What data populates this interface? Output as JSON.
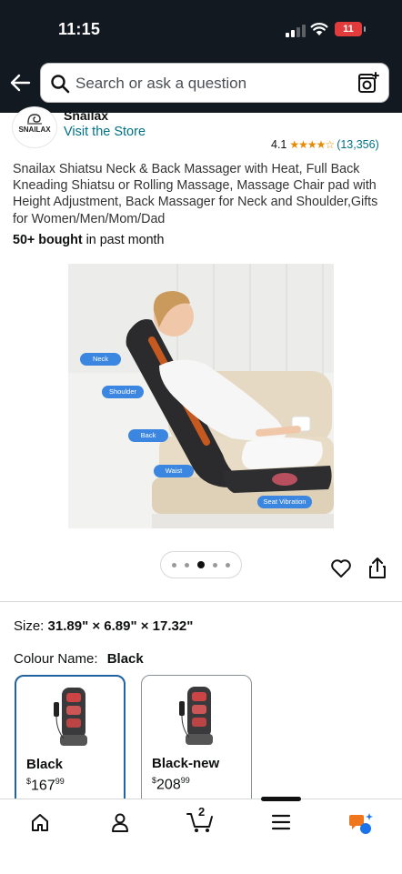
{
  "status_bar": {
    "time": "11:15",
    "battery": "11"
  },
  "search": {
    "placeholder": "Search or ask a question"
  },
  "brand": {
    "logo_text": "SNAILAX",
    "name": "Snailax",
    "visit_store": "Visit the Store"
  },
  "rating": {
    "value": "4.1",
    "stars": "★★★★☆",
    "count": "(13,356)"
  },
  "product": {
    "title": "Snailax Shiatsu Neck & Back Massager with Heat, Full Back Kneading Shiatsu or Rolling Massage, Massage Chair pad with Height Adjustment, Back Massager for Neck and Shoulder,Gifts for Women/Men/Mom/Dad",
    "bought_bold": "50+ bought",
    "bought_rest": " in past month"
  },
  "image_labels": {
    "neck": "Neck",
    "shoulder": "Shoulder",
    "back": "Back",
    "waist": "Waist",
    "seat": "Seat Vibration"
  },
  "carousel": {
    "count": 5,
    "active_index": 2
  },
  "size": {
    "label": "Size:",
    "value": "31.89\" × 6.89\" × 17.32\""
  },
  "colour": {
    "label": "Colour Name:",
    "value": "Black"
  },
  "variants": [
    {
      "name": "Black",
      "currency": "$",
      "whole": "167",
      "fraction": "99",
      "selected": true
    },
    {
      "name": "Black-new",
      "currency": "$",
      "whole": "208",
      "fraction": "99",
      "selected": false
    }
  ],
  "cart": {
    "count": "2"
  },
  "colors": {
    "nav_bg": "#131921",
    "link": "#007185",
    "star": "#E88A00",
    "selected_border": "#2162a1",
    "tag_blue": "#3b86e0",
    "assistant": "#f0761e"
  }
}
